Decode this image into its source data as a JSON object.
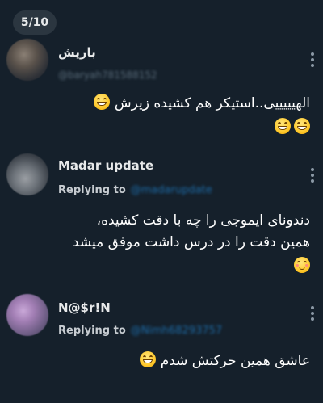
{
  "viewer": {
    "counter_text": "5/10"
  },
  "replies": [
    {
      "display_name": "باریش",
      "handle": "@baryah781588152",
      "replying_to_label": "",
      "replying_to_handle": "",
      "text": "الهیییییی..استیکر هم کشیده زیرش",
      "emoji": [
        "grinning-emoji",
        "grinning-emoji",
        "grinning-emoji"
      ]
    },
    {
      "display_name": "Madar update",
      "handle": "",
      "replying_to_label": "Replying to",
      "replying_to_handle": "@madarupdate",
      "text_lines": [
        "دندونای ایموجی را چه با دقت کشیده،",
        "همین دقت را در درس داشت موفق میشد"
      ],
      "emoji": [
        "smiling-blush-emoji"
      ]
    },
    {
      "display_name": "N@$r!N",
      "handle": "",
      "replying_to_label": "Replying to",
      "replying_to_handle": "@Nimh68293757",
      "text": "عاشق همین حرکتش شدم",
      "emoji": [
        "grinning-emoji"
      ]
    }
  ],
  "colors": {
    "background": "#15202b",
    "counter_bg": "#2b3640",
    "link_blue": "#1d6ca8",
    "muted_text": "#8b98a5"
  }
}
